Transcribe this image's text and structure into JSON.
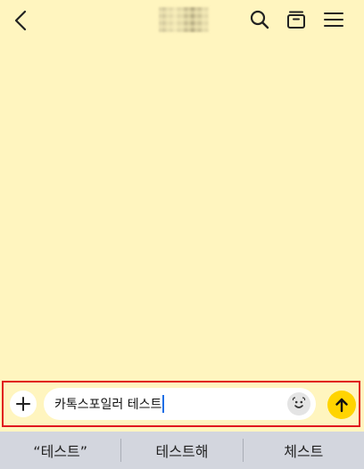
{
  "header": {
    "back_icon": "chevron-left-icon",
    "search_icon": "search-icon",
    "drawer_icon": "chat-drawer-icon",
    "menu_icon": "hamburger-menu-icon"
  },
  "composer": {
    "plus_icon": "plus-icon",
    "input_value": "카톡스포일러 테스트",
    "emoji_icon": "emoji-icon",
    "send_icon": "arrow-up-icon"
  },
  "suggestions": [
    "“테스트”",
    "테스트해",
    "체스트"
  ],
  "colors": {
    "background": "#fff5bf",
    "send_button": "#ffd400",
    "highlight_border": "#e0181f",
    "keyboard_bar": "#d3d6de",
    "caret": "#1f6fe6"
  }
}
